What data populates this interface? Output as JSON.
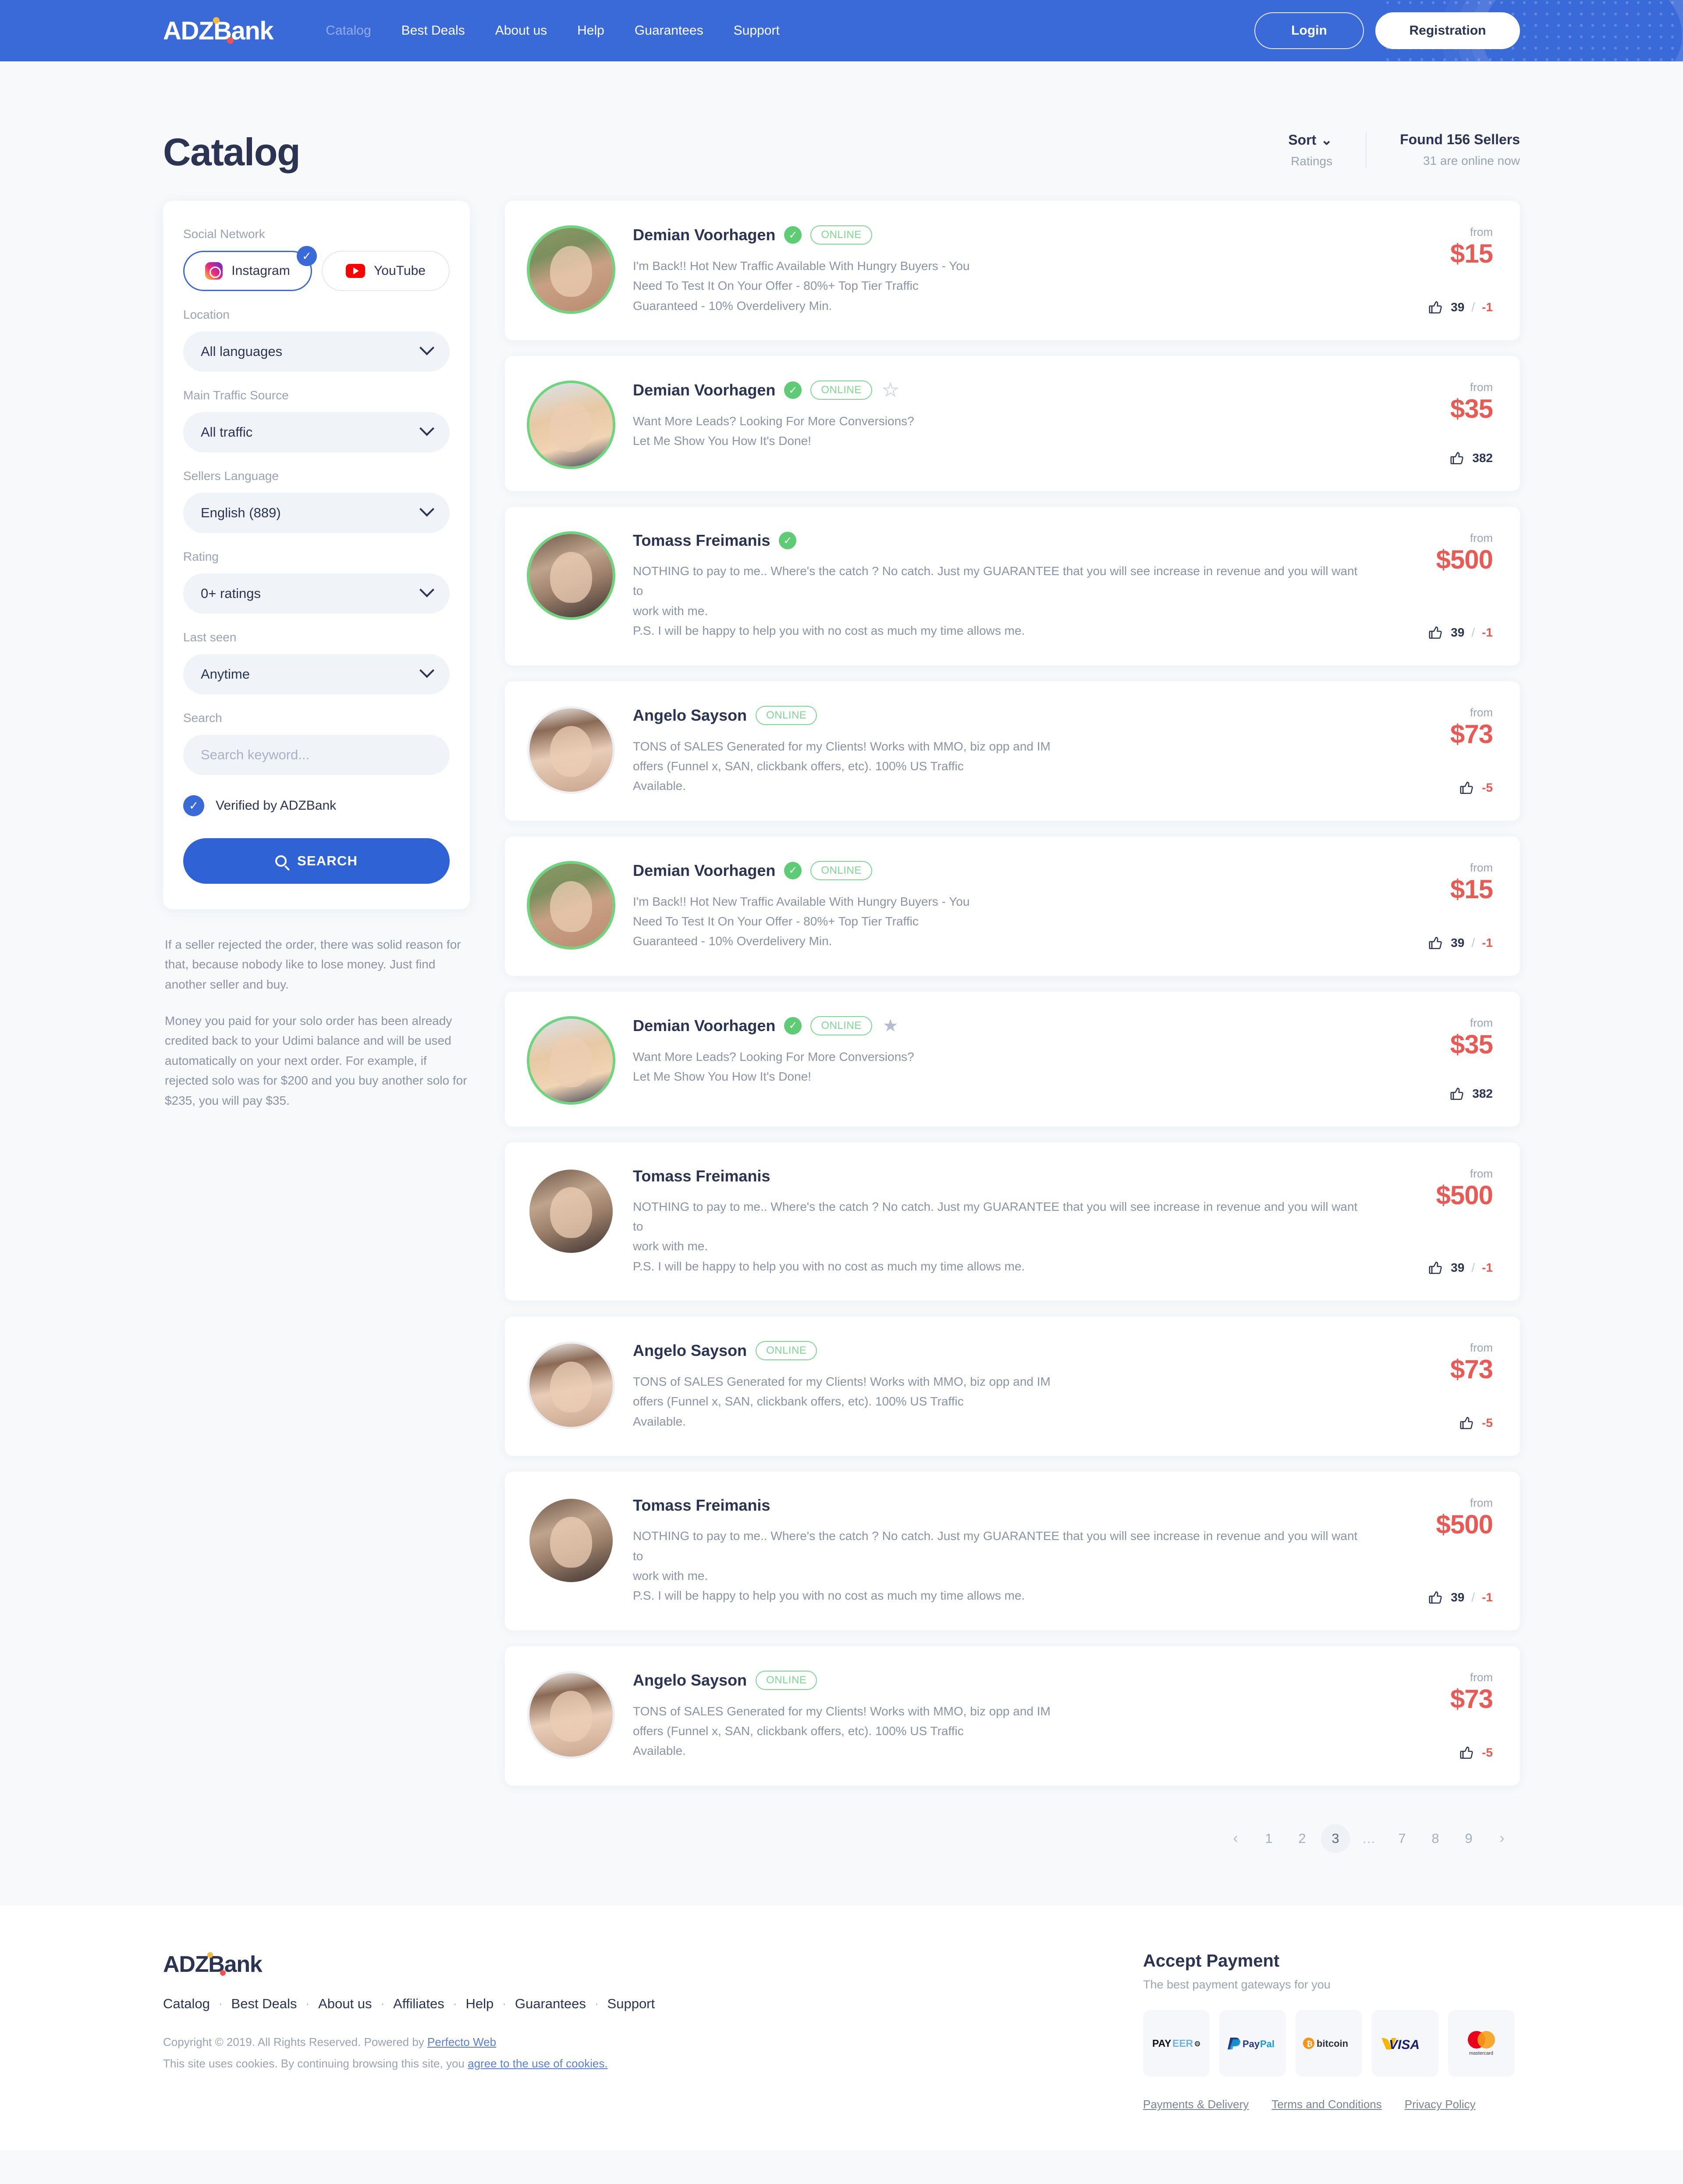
{
  "header": {
    "logo": "ADZBank",
    "nav": [
      {
        "label": "Catalog",
        "active": true
      },
      {
        "label": "Best Deals",
        "active": false
      },
      {
        "label": "About us",
        "active": false
      },
      {
        "label": "Help",
        "active": false
      },
      {
        "label": "Guarantees",
        "active": false
      },
      {
        "label": "Support",
        "active": false
      }
    ],
    "login_label": "Login",
    "registration_label": "Registration",
    "accent_color": "#3a69d8"
  },
  "page": {
    "title": "Catalog",
    "sort_label": "Sort",
    "sort_value": "Ratings",
    "found_label": "Found 156 Sellers",
    "found_sub": "31 are online now"
  },
  "filters": {
    "social_label": "Social Network",
    "social_options": [
      {
        "label": "Instagram",
        "icon": "instagram-icon",
        "selected": true
      },
      {
        "label": "YouTube",
        "icon": "youtube-icon",
        "selected": false
      }
    ],
    "location_label": "Location",
    "location_value": "All languages",
    "traffic_label": "Main Traffic Source",
    "traffic_value": "All traffic",
    "sellers_language_label": "Sellers Language",
    "sellers_language_value": "English (889)",
    "rating_label": "Rating",
    "rating_value": "0+ ratings",
    "last_seen_label": "Last seen",
    "last_seen_value": "Anytime",
    "search_label": "Search",
    "search_placeholder": "Search keyword...",
    "search_value": "",
    "verified_label": "Verified by ADZBank",
    "verified_checked": true,
    "search_button": "SEARCH"
  },
  "side_note": {
    "p1": "If a seller rejected the order, there was solid reason for that, because nobody like to lose money. Just find another seller and buy.",
    "p2": "Money you paid for your solo order has been already credited back to your Udimi balance and will be used automatically on your next order. For example, if rejected solo was for $200 and you buy another solo for $235, you will pay $35."
  },
  "labels": {
    "from": "from",
    "online": "ONLINE"
  },
  "sellers": [
    {
      "name": "Demian Voorhagen",
      "verified": true,
      "online": true,
      "star": "none",
      "avatar": "av-a",
      "ring": "ring-green",
      "desc1": "I'm Back!! Hot New Traffic Available With Hungry Buyers - You",
      "desc2": "Need To Test It On Your Offer - 80%+ Top Tier Traffic",
      "desc3": "Guaranteed - 10% Overdelivery Min.",
      "price": "$15",
      "likes": "39",
      "dislikes": "-1",
      "show_dislikes": true
    },
    {
      "name": "Demian Voorhagen",
      "verified": true,
      "online": true,
      "star": "outline",
      "avatar": "av-b",
      "ring": "ring-green",
      "desc1": "Want More Leads? Looking For More Conversions?",
      "desc2": "Let Me Show You How It's Done!",
      "desc3": "",
      "price": "$35",
      "likes": "382",
      "dislikes": "",
      "show_dislikes": false
    },
    {
      "name": "Tomass Freimanis",
      "verified": true,
      "online": false,
      "star": "none",
      "avatar": "av-c",
      "ring": "ring-green",
      "desc1": "NOTHING to pay to me.. Where's the catch ? No catch. Just my GUARANTEE that you will see increase in revenue and you will want to",
      "desc2": "work with me.",
      "desc3": "P.S. I will be happy to help you with no cost as much my time allows me.",
      "price": "$500",
      "likes": "39",
      "dislikes": "-1",
      "show_dislikes": true
    },
    {
      "name": "Angelo Sayson",
      "verified": false,
      "online": true,
      "star": "none",
      "avatar": "av-d",
      "ring": "ring-gray",
      "desc1": "TONS of SALES Generated for my Clients! Works with MMO, biz opp and IM",
      "desc2": "offers (Funnel x, SAN, clickbank offers, etc). 100% US Traffic",
      "desc3": "Available.",
      "price": "$73",
      "likes": "",
      "dislikes": "-5",
      "show_dislikes": true
    },
    {
      "name": "Demian Voorhagen",
      "verified": true,
      "online": true,
      "star": "none",
      "avatar": "av-a",
      "ring": "ring-green",
      "desc1": "I'm Back!! Hot New Traffic Available With Hungry Buyers - You",
      "desc2": "Need To Test It On Your Offer - 80%+ Top Tier Traffic",
      "desc3": "Guaranteed - 10% Overdelivery Min.",
      "price": "$15",
      "likes": "39",
      "dislikes": "-1",
      "show_dislikes": true
    },
    {
      "name": "Demian Voorhagen",
      "verified": true,
      "online": true,
      "star": "filled",
      "avatar": "av-b",
      "ring": "ring-green",
      "desc1": "Want More Leads? Looking For More Conversions?",
      "desc2": "Let Me Show You How It's Done!",
      "desc3": "",
      "price": "$35",
      "likes": "382",
      "dislikes": "",
      "show_dislikes": false
    },
    {
      "name": "Tomass Freimanis",
      "verified": false,
      "online": false,
      "star": "none",
      "avatar": "av-c",
      "ring": "ring-none",
      "desc1": "NOTHING to pay to me.. Where's the catch ? No catch. Just my GUARANTEE that you will see increase in revenue and you will want to",
      "desc2": "work with me.",
      "desc3": "P.S. I will be happy to help you with no cost as much my time allows me.",
      "price": "$500",
      "likes": "39",
      "dislikes": "-1",
      "show_dislikes": true
    },
    {
      "name": "Angelo Sayson",
      "verified": false,
      "online": true,
      "star": "none",
      "avatar": "av-d",
      "ring": "ring-gray",
      "desc1": "TONS of SALES Generated for my Clients! Works with MMO, biz opp and IM",
      "desc2": "offers (Funnel x, SAN, clickbank offers, etc). 100% US Traffic",
      "desc3": "Available.",
      "price": "$73",
      "likes": "",
      "dislikes": "-5",
      "show_dislikes": true
    },
    {
      "name": "Tomass Freimanis",
      "verified": false,
      "online": false,
      "star": "none",
      "avatar": "av-c",
      "ring": "ring-none",
      "desc1": "NOTHING to pay to me.. Where's the catch ? No catch. Just my GUARANTEE that you will see increase in revenue and you will want to",
      "desc2": "work with me.",
      "desc3": "P.S. I will be happy to help you with no cost as much my time allows me.",
      "price": "$500",
      "likes": "39",
      "dislikes": "-1",
      "show_dislikes": true
    },
    {
      "name": "Angelo Sayson",
      "verified": false,
      "online": true,
      "star": "none",
      "avatar": "av-d",
      "ring": "ring-gray",
      "desc1": "TONS of SALES Generated for my Clients! Works with MMO, biz opp and IM",
      "desc2": "offers (Funnel x, SAN, clickbank offers, etc). 100% US Traffic",
      "desc3": "Available.",
      "price": "$73",
      "likes": "",
      "dislikes": "-5",
      "show_dislikes": true
    }
  ],
  "pagination": {
    "prev": "‹",
    "next": "›",
    "pages": [
      "1",
      "2",
      "3",
      "…",
      "7",
      "8",
      "9"
    ],
    "current": "3"
  },
  "footer": {
    "logo": "ADZBank",
    "nav": [
      "Catalog",
      "Best Deals",
      "About us",
      "Affiliates",
      "Help",
      "Guarantees",
      "Support"
    ],
    "separator": "·",
    "copyright_prefix": "Copyright © 2019. All Rights Reserved. Powered by ",
    "copyright_link": "Perfecto Web",
    "cookie_prefix": "This site uses cookies. By continuing browsing this site, you ",
    "cookie_link": "agree to the use of cookies.",
    "payment_title": "Accept Payment",
    "payment_sub": "The best payment gateways for you",
    "payment_methods": [
      {
        "name": "payeer-logo"
      },
      {
        "name": "paypal-logo"
      },
      {
        "name": "bitcoin-logo"
      },
      {
        "name": "visa-logo"
      },
      {
        "name": "mastercard-logo"
      }
    ],
    "legal_links": [
      "Payments & Delivery",
      "Terms and Conditions",
      "Privacy Policy"
    ]
  }
}
